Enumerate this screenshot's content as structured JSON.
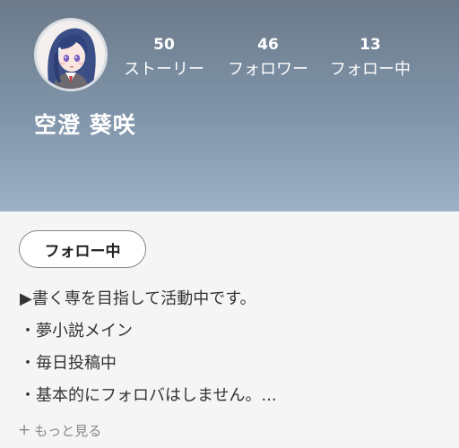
{
  "profile": {
    "name": "空澄 葵咲",
    "avatar": "avatar-girl-illustration",
    "stats": [
      {
        "num": "50",
        "label": "ストーリー"
      },
      {
        "num": "46",
        "label": "フォロワー"
      },
      {
        "num": "13",
        "label": "フォロー中"
      }
    ]
  },
  "actions": {
    "follow_label": "フォロー中"
  },
  "bio": {
    "lines": [
      "▶書く専を目指して活動中です。",
      "・夢小説メイン",
      "・毎日投稿中",
      "・基本的にフォロバはしません。..."
    ],
    "more_label": "もっと見る",
    "more_icon": "plus-icon"
  },
  "colors": {
    "header_top": "#6b7a8a",
    "header_bottom": "#9db1c6",
    "background": "#f5f5f5"
  }
}
